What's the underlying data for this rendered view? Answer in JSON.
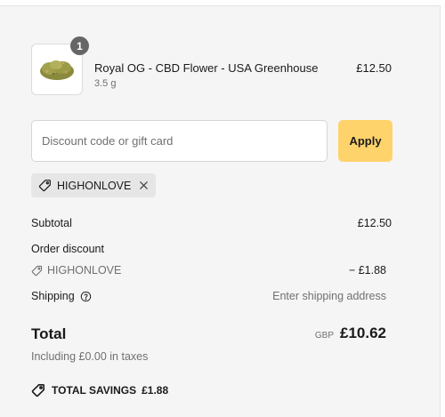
{
  "cart": {
    "items": [
      {
        "name": "Royal OG - CBD Flower - USA Greenhouse",
        "variant": "3.5 g",
        "price": "£12.50",
        "quantity": "1",
        "image_icon": "cbd-flower-bud-image"
      }
    ]
  },
  "discount": {
    "placeholder": "Discount code or gift card",
    "value": "",
    "apply_label": "Apply",
    "applied_code": "HIGHONLOVE"
  },
  "summary": {
    "subtotal_label": "Subtotal",
    "subtotal_value": "£12.50",
    "order_discount_label": "Order discount",
    "discount_code": "HIGHONLOVE",
    "discount_value": "− £1.88",
    "shipping_label": "Shipping",
    "shipping_value": "Enter shipping address",
    "total_label": "Total",
    "currency": "GBP",
    "total_value": "£10.62",
    "taxes_note": "Including £0.00 in taxes",
    "savings_label": "TOTAL SAVINGS",
    "savings_value": "£1.88"
  },
  "colors": {
    "panel_bg": "#f5f5f5",
    "apply_button": "#fed36c",
    "badge": "#666666",
    "chip_bg": "#e6e6e6",
    "muted_text": "#707070"
  }
}
